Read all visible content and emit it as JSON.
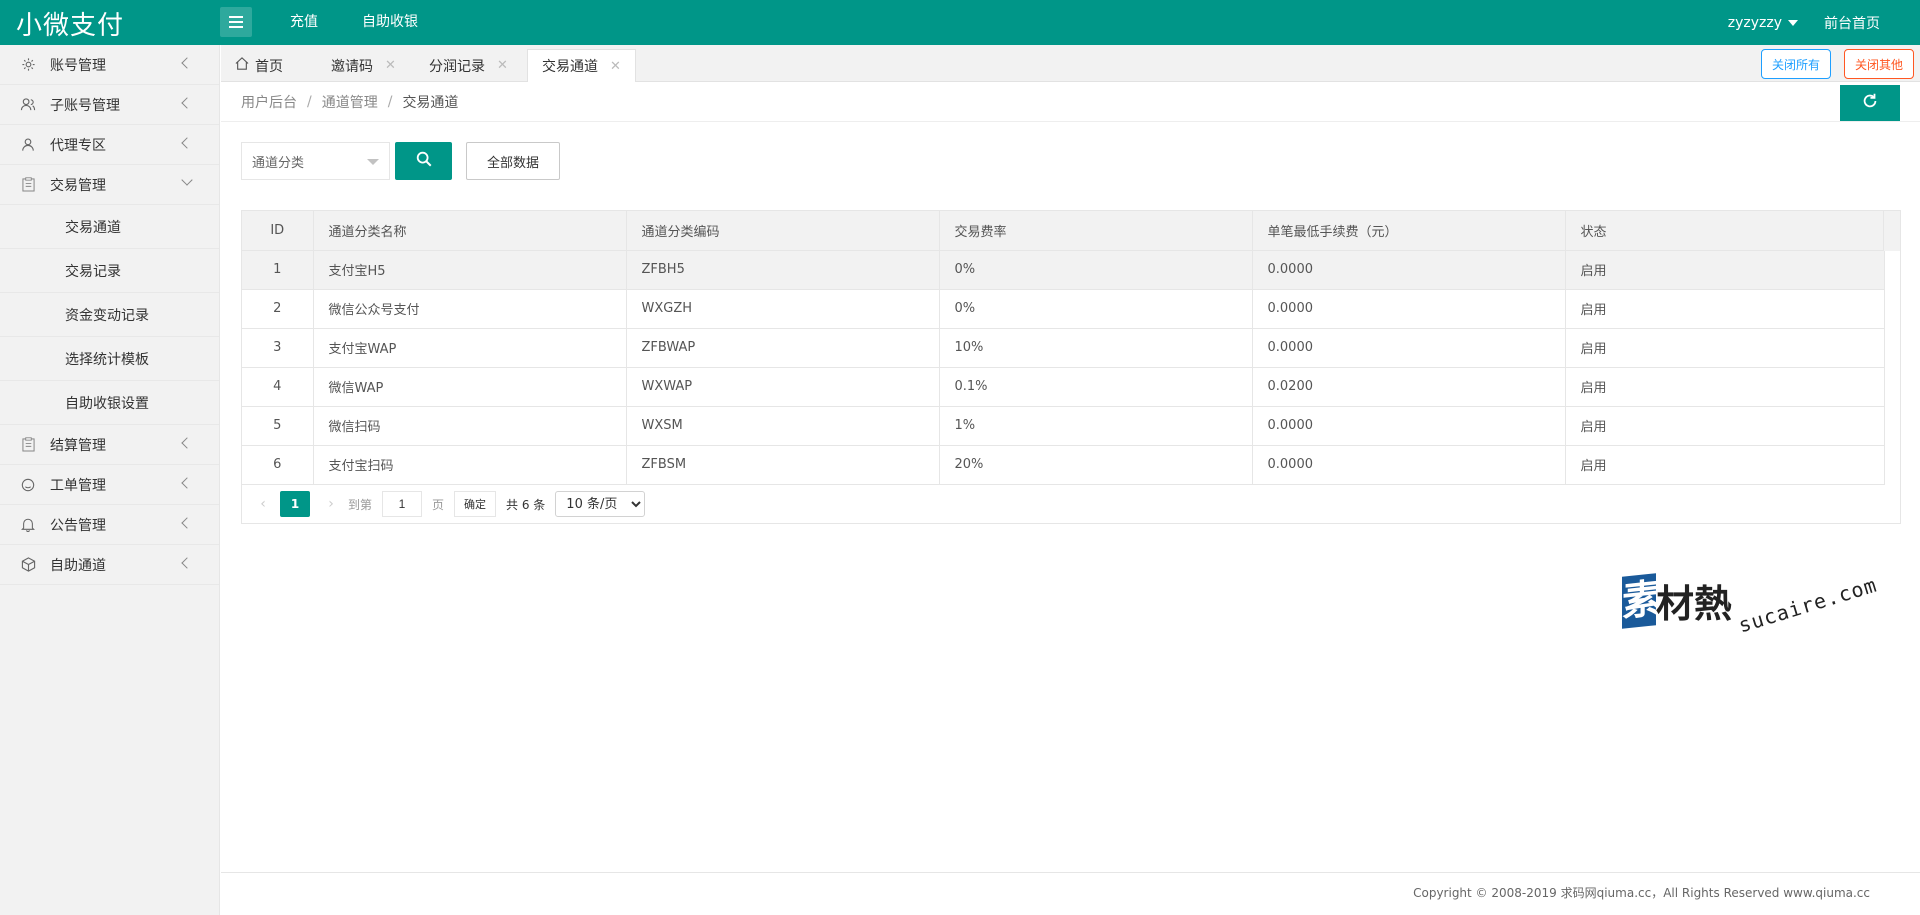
{
  "header": {
    "logo": "小微支付",
    "nav": [
      "充值",
      "自助收银"
    ],
    "user": "zyzyzzy",
    "front_home": "前台首页"
  },
  "sidebar": {
    "items": [
      {
        "label": "账号管理",
        "icon": "gear-icon"
      },
      {
        "label": "子账号管理",
        "icon": "users-icon"
      },
      {
        "label": "代理专区",
        "icon": "user-icon"
      },
      {
        "label": "交易管理",
        "icon": "clipboard-icon"
      }
    ],
    "sub_items": [
      "交易通道",
      "交易记录",
      "资金变动记录",
      "选择统计模板",
      "自助收银设置"
    ],
    "items_after": [
      {
        "label": "结算管理",
        "icon": "clipboard-icon"
      },
      {
        "label": "工单管理",
        "icon": "smile-icon"
      },
      {
        "label": "公告管理",
        "icon": "bell-icon"
      },
      {
        "label": "自助通道",
        "icon": "cube-icon"
      }
    ]
  },
  "tabs": [
    "首页",
    "邀请码",
    "分润记录",
    "交易通道"
  ],
  "tab_actions": {
    "close_all": "关闭所有",
    "close_other": "关闭其他"
  },
  "breadcrumb": [
    "用户后台",
    "通道管理",
    "交易通道"
  ],
  "filter": {
    "select_placeholder": "通道分类",
    "all_data": "全部数据"
  },
  "table": {
    "headers": [
      "ID",
      "通道分类名称",
      "通道分类编码",
      "交易费率",
      "单笔最低手续费（元）",
      "状态"
    ],
    "rows": [
      [
        "1",
        "支付宝H5",
        "ZFBH5",
        "0%",
        "0.0000",
        "启用"
      ],
      [
        "2",
        "微信公众号支付",
        "WXGZH",
        "0%",
        "0.0000",
        "启用"
      ],
      [
        "3",
        "支付宝WAP",
        "ZFBWAP",
        "10%",
        "0.0000",
        "启用"
      ],
      [
        "4",
        "微信WAP",
        "WXWAP",
        "0.1%",
        "0.0200",
        "启用"
      ],
      [
        "5",
        "微信扫码",
        "WXSM",
        "1%",
        "0.0000",
        "启用"
      ],
      [
        "6",
        "支付宝扫码",
        "ZFBSM",
        "20%",
        "0.0000",
        "启用"
      ]
    ]
  },
  "pager": {
    "current": "1",
    "goto_label": "到第",
    "goto_value": "1",
    "page_label": "页",
    "ok": "确定",
    "total": "共 6 条",
    "page_size": "10 条/页"
  },
  "watermark": {
    "box": "素",
    "text": "材熱",
    "url": "sucaire.com"
  },
  "footer": "Copyright © 2008-2019 求码网qiuma.cc，All Rights Reserved www.qiuma.cc",
  "colors": {
    "primary": "#009688",
    "close_all": "#1E9FFF",
    "close_other": "#FF5722"
  }
}
